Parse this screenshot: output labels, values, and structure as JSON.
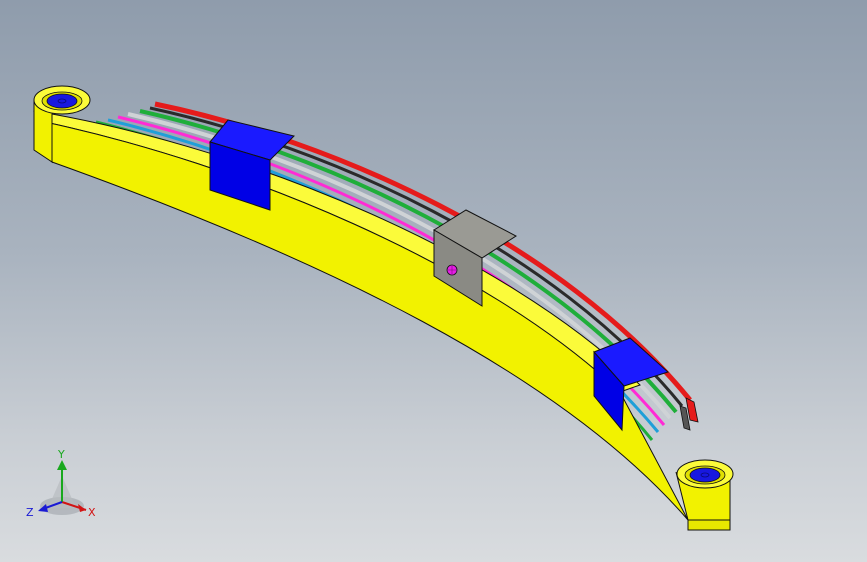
{
  "viewport": {
    "background_top": "#8f9cac",
    "background_bottom": "#d9dcdf"
  },
  "model": {
    "leaf_colors": [
      "#e51b1b",
      "#2a2a2a",
      "#1fae3a",
      "#cfd3d6",
      "#ff2bd5",
      "#1f9fd8"
    ],
    "main_leaf_color": "#f2f200",
    "clamp_color": "#0000e6",
    "center_block_color": "#8a8a84",
    "bolt_color": "#e61ee6",
    "eye_bushing_color": "#1818e0"
  },
  "triad": {
    "x_label": "X",
    "y_label": "Y",
    "z_label": "Z",
    "x_color": "#d21414",
    "y_color": "#19a81e",
    "z_color": "#1a1ad4"
  }
}
